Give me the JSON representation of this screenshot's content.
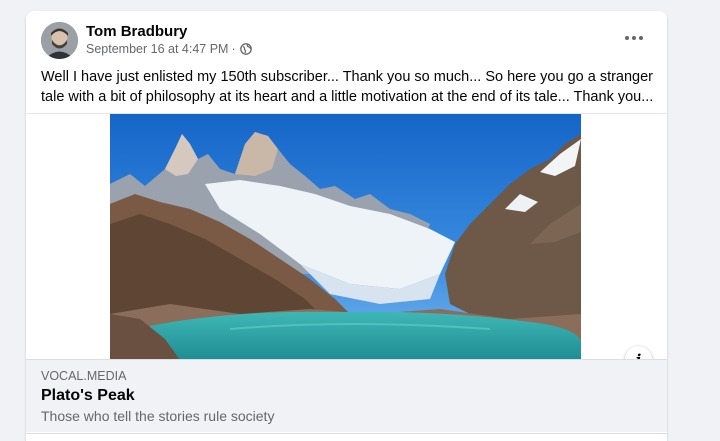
{
  "post": {
    "author": "Tom Bradbury",
    "timestamp": "September 16 at 4:47 PM",
    "separator": "·",
    "privacy_icon": "globe-icon",
    "more_icon": "more-options-icon",
    "text": "Well I have just enlisted my 150th subscriber... Thank you so much... So here you go a stranger tale with a bit of philosophy at its heart and a little motivation at the end of its tale... Thank you..."
  },
  "link_preview": {
    "domain": "VOCAL.MEDIA",
    "title": "Plato's Peak",
    "subtitle": "Those who tell the stories rule society",
    "info_icon": "info-icon",
    "info_label": "i"
  },
  "colors": {
    "background": "#f0f2f5",
    "card": "#ffffff",
    "primary_text": "#050505",
    "secondary_text": "#65676b"
  }
}
